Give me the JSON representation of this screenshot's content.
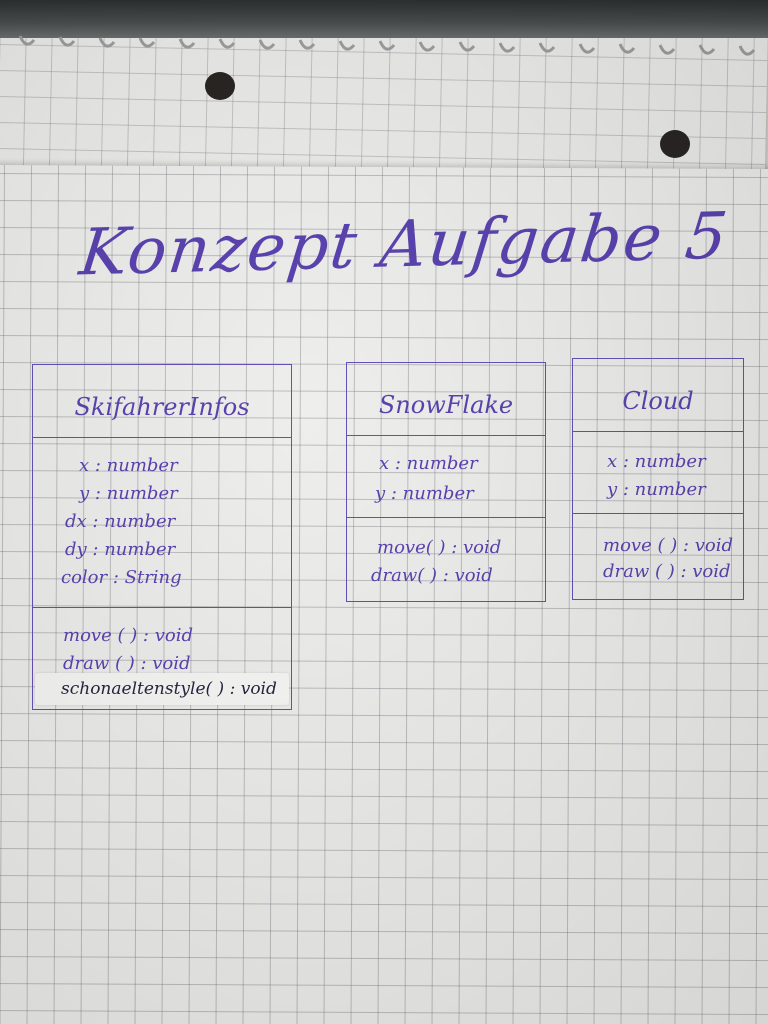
{
  "title": "Konzept Aufgabe 5",
  "colors": {
    "ink": "#5b43b0",
    "paper": "#eeeeec",
    "grid": "#8a8a94"
  },
  "classes": [
    {
      "name": "SkifahrerInfos",
      "attributes": [
        "x : number",
        "y : number",
        "dx : number",
        "dy : number",
        "color : String"
      ],
      "methods": [
        "move ( ) : void",
        "draw ( ) : void",
        "schonaeltenstyle( ) : void"
      ]
    },
    {
      "name": "SnowFlake",
      "attributes": [
        "x : number",
        "y : number"
      ],
      "methods": [
        "move( ) : void",
        "draw( ) : void"
      ]
    },
    {
      "name": "Cloud",
      "attributes": [
        "x : number",
        "y : number"
      ],
      "methods": [
        "move ( ) : void",
        "draw ( ) : void"
      ]
    }
  ]
}
